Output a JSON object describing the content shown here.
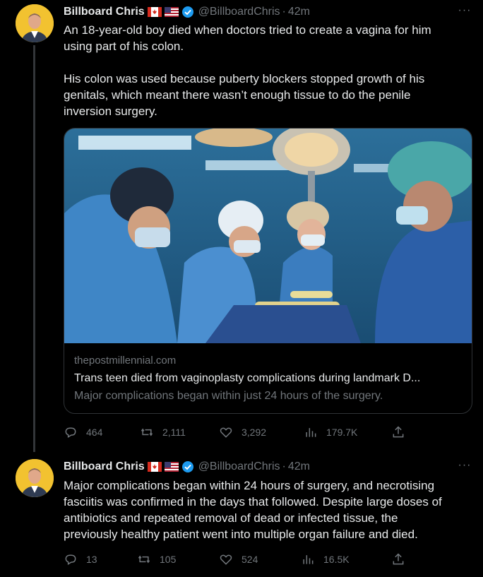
{
  "tweets": [
    {
      "author": {
        "name": "Billboard Chris",
        "handle": "@BillboardChris",
        "time": "42m",
        "flags": [
          "canada-flag",
          "us-flag"
        ]
      },
      "text_lines": [
        "An 18-year-old boy died when doctors tried to create a vagina for him",
        "using part of his colon.",
        "",
        "His colon was used because puberty blockers stopped growth of his",
        "genitals, which meant there wasn’t enough tissue to do the penile",
        "inversion surgery."
      ],
      "card": {
        "image": "surgery-operating-room-photo",
        "domain": "thepostmillennial.com",
        "title": "Trans teen died from vaginoplasty complications during landmark D...",
        "description": "Major complications began within just 24 hours of the surgery."
      },
      "stats": {
        "replies": "464",
        "reposts": "2,111",
        "likes": "3,292",
        "views": "179.7K"
      }
    },
    {
      "author": {
        "name": "Billboard Chris",
        "handle": "@BillboardChris",
        "time": "42m",
        "flags": [
          "canada-flag",
          "us-flag"
        ]
      },
      "text_lines": [
        "Major complications began within 24 hours of surgery, and necrotising",
        "fasciitis was confirmed in the days that followed. Despite large doses of",
        "antibiotics and repeated removal of dead or infected tissue, the",
        "previously healthy patient went into multiple organ failure and died."
      ],
      "stats": {
        "replies": "13",
        "reposts": "105",
        "likes": "524",
        "views": "16.5K"
      }
    }
  ],
  "more_icon": "···",
  "colors": {
    "background": "#000000",
    "text": "#e7e9ea",
    "muted": "#71767b",
    "verified": "#1d9bf0",
    "avatar_bg": "#f2c230"
  }
}
